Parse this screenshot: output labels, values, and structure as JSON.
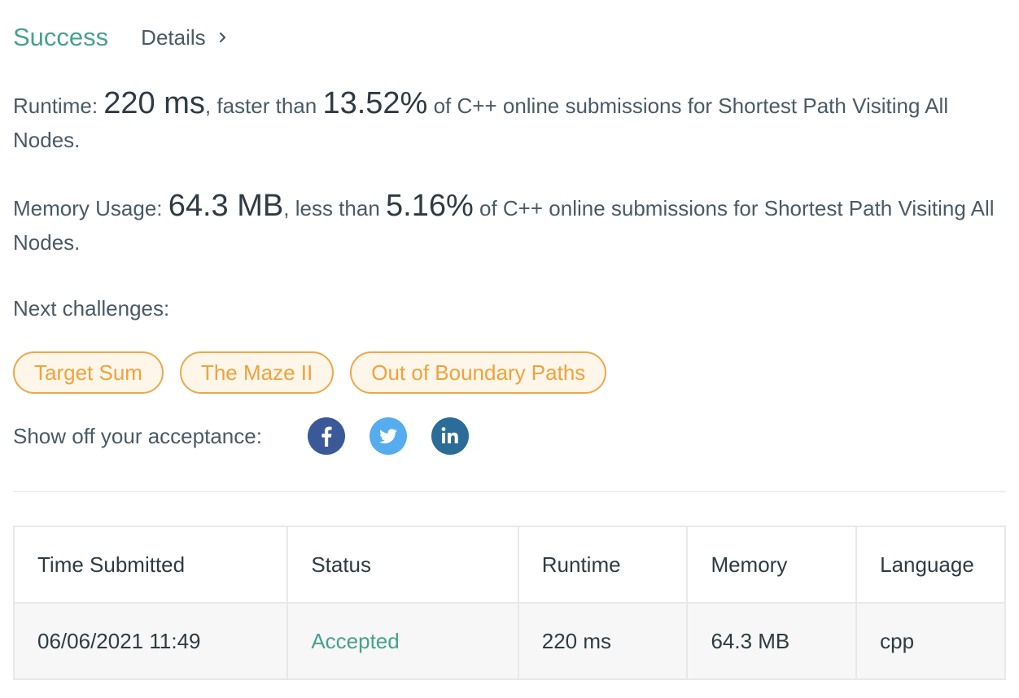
{
  "header": {
    "status": "Success",
    "details_label": "Details"
  },
  "runtime": {
    "label": "Runtime:",
    "value": "220 ms",
    "mid_text": ", faster than",
    "percent": "13.52%",
    "tail_text": "of C++ online submissions for Shortest Path Visiting All Nodes."
  },
  "memory": {
    "label": "Memory Usage:",
    "value": "64.3 MB",
    "mid_text": ", less than",
    "percent": "5.16%",
    "tail_text": "of C++ online submissions for Shortest Path Visiting All Nodes."
  },
  "next": {
    "label": "Next challenges:",
    "challenges": [
      "Target Sum",
      "The Maze II",
      "Out of Boundary Paths"
    ]
  },
  "share": {
    "label": "Show off your acceptance:",
    "icons": [
      "facebook-icon",
      "twitter-icon",
      "linkedin-icon"
    ]
  },
  "table": {
    "headers": [
      "Time Submitted",
      "Status",
      "Runtime",
      "Memory",
      "Language"
    ],
    "rows": [
      [
        "06/06/2021 11:49",
        "Accepted",
        "220 ms",
        "64.3 MB",
        "cpp"
      ]
    ]
  },
  "colors": {
    "success": "#46a28a",
    "chip_border": "#f0a64a",
    "chip_bg": "#fef6e9",
    "facebook": "#3b5998",
    "twitter": "#55acee",
    "linkedin": "#2b6c98"
  }
}
